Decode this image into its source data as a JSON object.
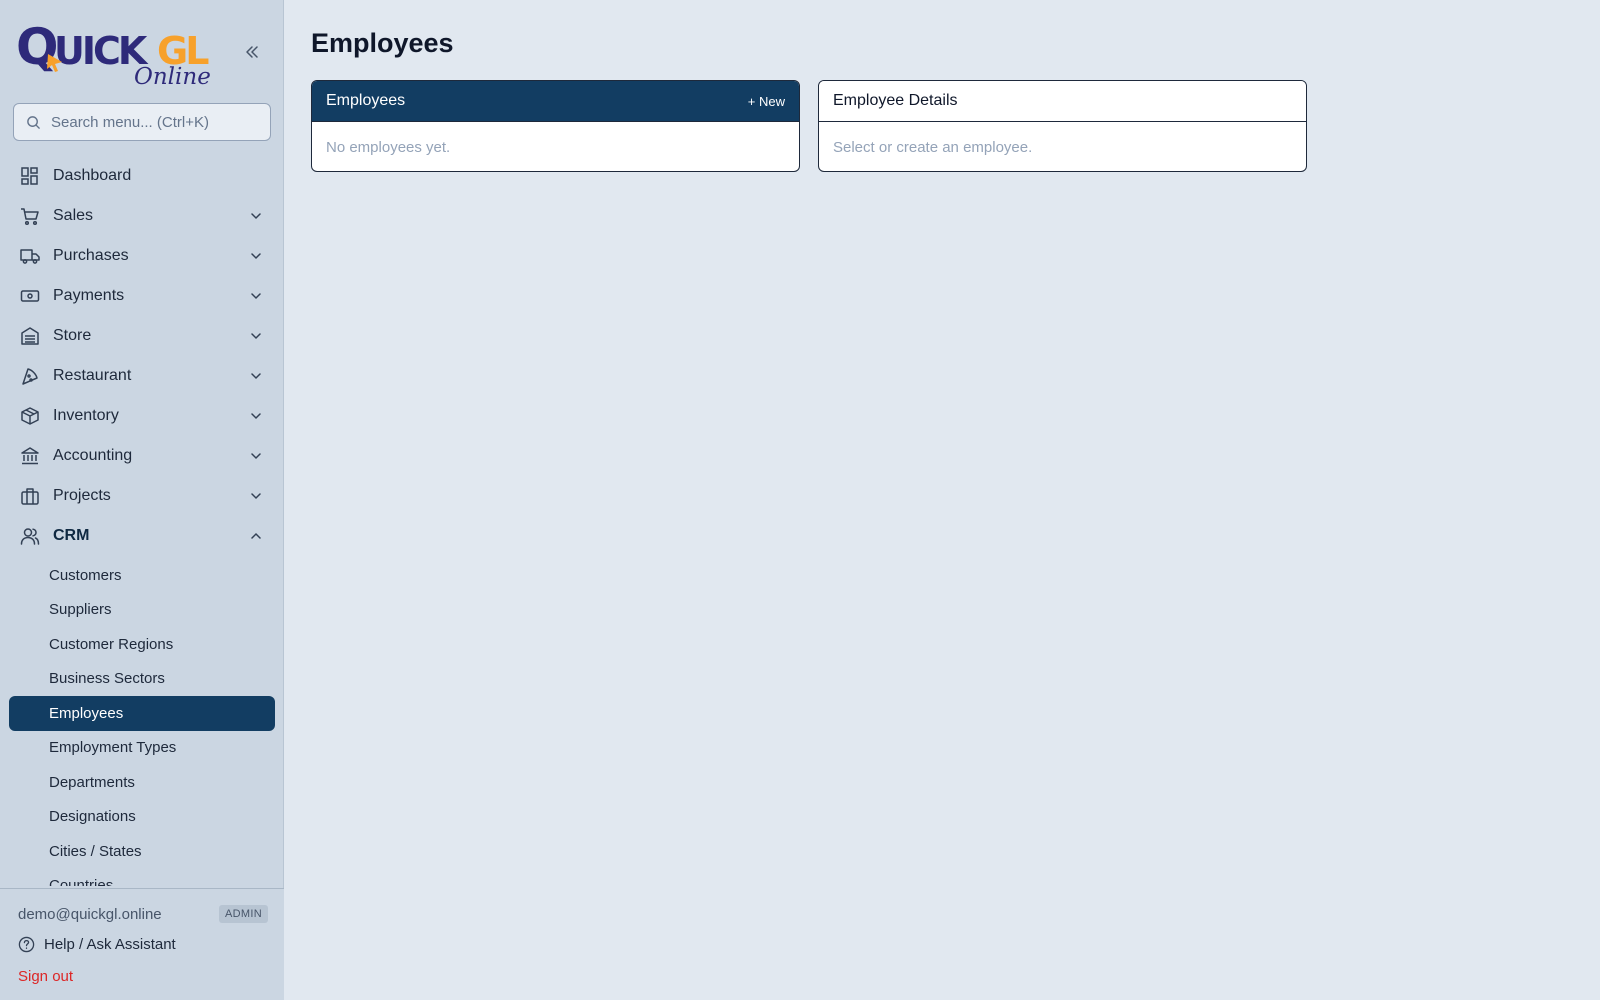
{
  "sidebar": {
    "logo_text": "QUICKGL",
    "logo_sub": "Online",
    "search": {
      "placeholder": "Search menu... (Ctrl+K)"
    },
    "items": [
      {
        "label": "Dashboard",
        "icon": "dashboard-icon"
      },
      {
        "label": "Sales",
        "icon": "cart-icon"
      },
      {
        "label": "Purchases",
        "icon": "truck-icon"
      },
      {
        "label": "Payments",
        "icon": "banknote-icon"
      },
      {
        "label": "Store",
        "icon": "warehouse-icon"
      },
      {
        "label": "Restaurant",
        "icon": "pizza-icon"
      },
      {
        "label": "Inventory",
        "icon": "package-icon"
      },
      {
        "label": "Accounting",
        "icon": "bank-icon"
      },
      {
        "label": "Projects",
        "icon": "briefcase-icon"
      },
      {
        "label": "CRM",
        "icon": "users-icon"
      }
    ],
    "crm_sub": [
      "Customers",
      "Suppliers",
      "Customer Regions",
      "Business Sectors",
      "Employees",
      "Employment Types",
      "Departments",
      "Designations",
      "Cities / States",
      "Countries"
    ],
    "footer": {
      "email": "demo@quickgl.online",
      "role": "ADMIN",
      "help": "Help / Ask Assistant",
      "signout": "Sign out"
    }
  },
  "main": {
    "title": "Employees",
    "list_card": {
      "title": "Employees",
      "new_label": "+ New",
      "empty": "No employees yet."
    },
    "detail_card": {
      "title": "Employee Details",
      "empty": "Select or create an employee."
    }
  },
  "colors": {
    "accent": "#123d62",
    "logo_navy": "#2e2a7a",
    "logo_orange": "#f7a12b",
    "danger": "#dc2626"
  }
}
